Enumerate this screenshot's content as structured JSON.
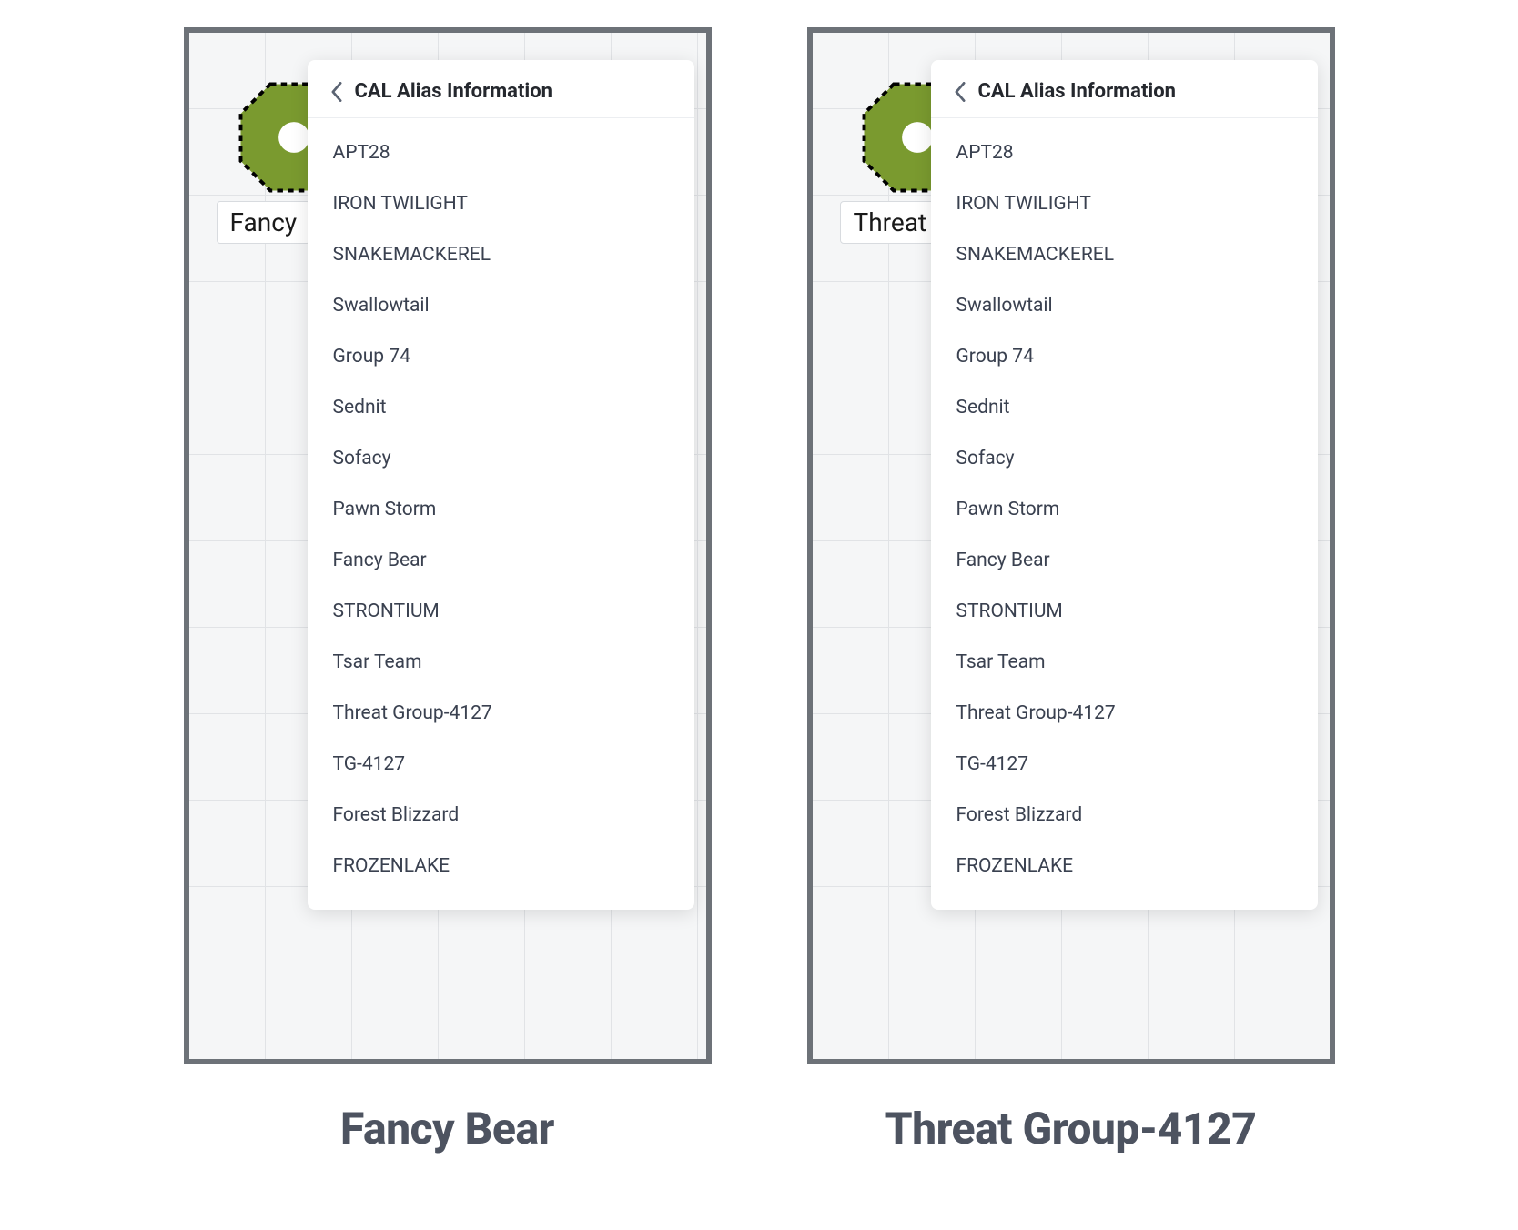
{
  "popup_title": "CAL Alias Information",
  "aliases": [
    "APT28",
    "IRON TWILIGHT",
    "SNAKEMACKEREL",
    "Swallowtail",
    "Group 74",
    "Sednit",
    "Sofacy",
    "Pawn Storm",
    "Fancy Bear",
    "STRONTIUM",
    "Tsar Team",
    "Threat Group-4127",
    "TG-4127",
    "Forest Blizzard",
    "FROZENLAKE"
  ],
  "panels": [
    {
      "node_label": "Fancy",
      "caption": "Fancy Bear"
    },
    {
      "node_label": "Threat Gr",
      "caption": "Threat Group-4127"
    }
  ],
  "colors": {
    "node_fill": "#7a9a2f",
    "node_stroke": "#000000",
    "panel_border": "#6d7278",
    "caption_text": "#4d5360"
  }
}
